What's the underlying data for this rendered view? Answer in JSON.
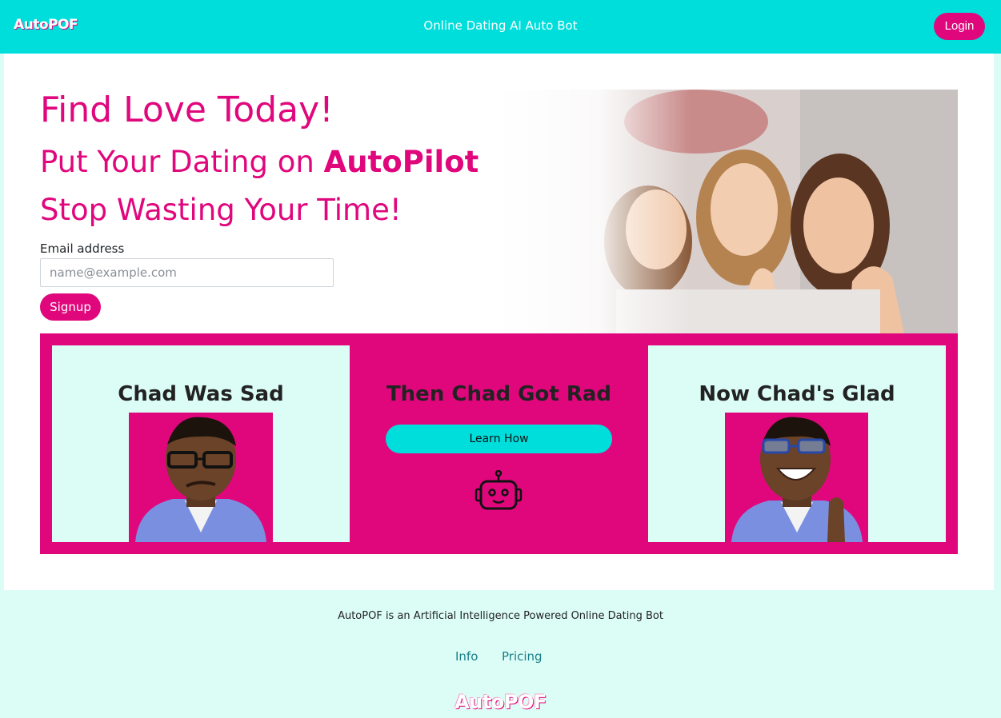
{
  "navbar": {
    "brand_part1": "Auto",
    "brand_part2": "POF",
    "tagline": "Online Dating AI Auto Bot",
    "login_label": "Login"
  },
  "hero": {
    "headline": "Find Love Today!",
    "subhead_prefix": "Put Your Dating on ",
    "subhead_bold": "AutoPilot",
    "subhead2": "Stop Wasting Your Time!",
    "email_label": "Email address",
    "email_placeholder": "name@example.com",
    "signup_label": "Signup"
  },
  "story": {
    "left_title": "Chad Was Sad",
    "mid_title": "Then Chad Got Rad",
    "learn_label": "Learn How",
    "right_title": "Now Chad's Glad"
  },
  "footer": {
    "description": "AutoPOF is an Artificial Intelligence Powered Online Dating Bot",
    "links": [
      "Info",
      "Pricing"
    ],
    "brand": "AutoPOF"
  },
  "colors": {
    "primary_pink": "#e0077d",
    "cyan": "#00dedb",
    "mint_bg": "#dcfdf6"
  }
}
